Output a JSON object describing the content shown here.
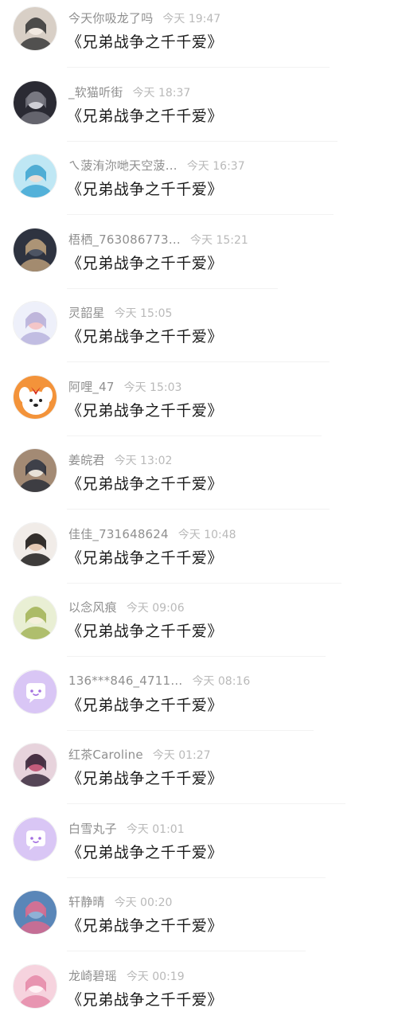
{
  "comments": [
    {
      "user": "今天你吸龙了吗",
      "time": "今天 19:47",
      "text": "《兄弟战争之千千爱》",
      "avatar": "anime-girl-avatar",
      "colors": [
        "#d8cfc6",
        "#3a3a3a",
        "#f1e9e1"
      ]
    },
    {
      "user": "_软猫听街",
      "time": "今天 18:37",
      "text": "《兄弟战争之千千爱》",
      "avatar": "dark-portrait-avatar",
      "colors": [
        "#2a2a33",
        "#6e6e78",
        "#cfcfd6"
      ]
    },
    {
      "user": "ㄟ菠洧沵哋天空菠…",
      "time": "今天 16:37",
      "text": "《兄弟战争之千千爱》",
      "avatar": "blue-photo-avatar",
      "colors": [
        "#bfe7f4",
        "#3fa7d4",
        "#e9dfd7"
      ]
    },
    {
      "user": "梧栖_763086773…",
      "time": "今天 15:21",
      "text": "《兄弟战争之千千爱》",
      "avatar": "night-photo-avatar",
      "colors": [
        "#2e3340",
        "#b79b78",
        "#4d5463"
      ]
    },
    {
      "user": "灵韶星",
      "time": "今天 15:05",
      "text": "《兄弟战争之千千爱》",
      "avatar": "anime-silver-hair-avatar",
      "colors": [
        "#eef0fa",
        "#b9b4dd",
        "#f4c6c8"
      ]
    },
    {
      "user": "阿哩_47",
      "time": "今天 15:03",
      "text": "《兄弟战争之千千爱》",
      "avatar": "cartoon-dog-avatar",
      "colors": [
        "#f3933a",
        "#ffffff",
        "#d9331f"
      ]
    },
    {
      "user": "姜皖君",
      "time": "今天 13:02",
      "text": "《兄弟战争之千千爱》",
      "avatar": "street-photo-avatar",
      "colors": [
        "#a38a74",
        "#2b2f3a",
        "#e8e2d8"
      ]
    },
    {
      "user": "佳佳_731648624",
      "time": "今天 10:48",
      "text": "《兄弟战争之千千爱》",
      "avatar": "selfie-avatar",
      "colors": [
        "#f1ece8",
        "#1f1d1c",
        "#e6c9b3"
      ]
    },
    {
      "user": "以念风痕",
      "time": "今天 09:06",
      "text": "《兄弟战争之千千爱》",
      "avatar": "anime-green-avatar",
      "colors": [
        "#e9efd4",
        "#a4b55a",
        "#f5f0dc"
      ]
    },
    {
      "user": "136***846_4711…",
      "time": "今天 08:16",
      "text": "《兄弟战争之千千爱》",
      "avatar": "default-chat-bubble-avatar",
      "colors": [
        "#d9c6f5",
        "#ffffff",
        "#a36fe0"
      ]
    },
    {
      "user": "红茶Caroline",
      "time": "今天 01:27",
      "text": "《兄弟战争之千千爱》",
      "avatar": "anime-dark-avatar",
      "colors": [
        "#e7d3dc",
        "#3b2b3e",
        "#c25c7b"
      ]
    },
    {
      "user": "白雪丸子",
      "time": "今天 01:01",
      "text": "《兄弟战争之千千爱》",
      "avatar": "default-chat-bubble-avatar",
      "colors": [
        "#d9c6f5",
        "#ffffff",
        "#a36fe0"
      ]
    },
    {
      "user": "轩静晴",
      "time": "今天 00:20",
      "text": "《兄弟战争之千千爱》",
      "avatar": "flower-photo-avatar",
      "colors": [
        "#5a86b8",
        "#d86a8e",
        "#8fb1d6"
      ]
    },
    {
      "user": "龙崎碧瑶",
      "time": "今天 00:19",
      "text": "《兄弟战争之千千爱》",
      "avatar": "anime-pink-avatar",
      "colors": [
        "#f6d3de",
        "#e58aa9",
        "#fff2f5"
      ]
    }
  ]
}
